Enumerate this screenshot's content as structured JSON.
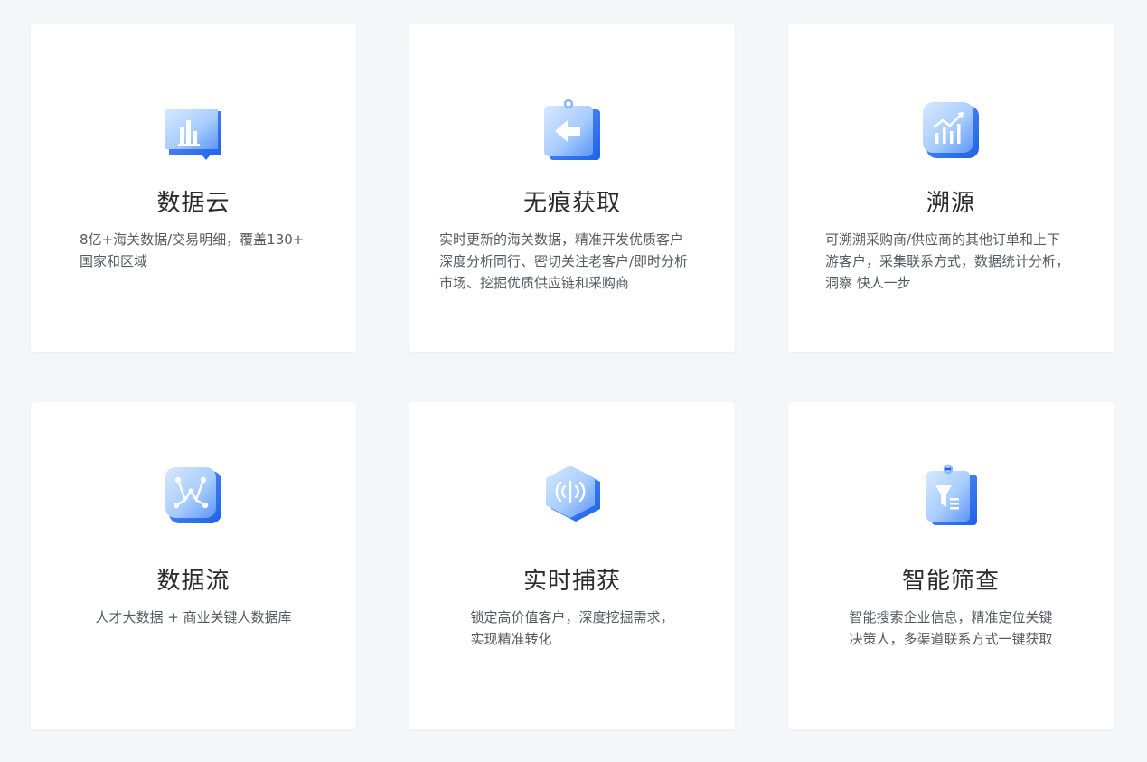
{
  "colors": {
    "page_background": "#f4f7fa",
    "card_background": "#ffffff",
    "title_text": "#2b2b2b",
    "body_text": "#555a60",
    "icon_light": "#bcd9ff",
    "icon_dark": "#2a6ff0"
  },
  "cards": [
    {
      "icon": "bar-chart-icon",
      "title": "数据云",
      "desc_lines": [
        "8亿+海关数据/交易明细，覆盖130+",
        "国家和区域"
      ]
    },
    {
      "icon": "clipboard-arrow-icon",
      "title": "无痕获取",
      "desc_lines": [
        "实时更新的海关数据，精准开发优质客户",
        "深度分析同行、密切关注老客户/即时分析",
        "市场、挖掘优质供应链和采购商"
      ]
    },
    {
      "icon": "trend-chart-icon",
      "title": "溯源",
      "desc_lines": [
        "可溯溯采购商/供应商的其他订单和上下",
        "游客户，采集联系方式，数据统计分析，",
        "洞察 快人一步"
      ]
    },
    {
      "icon": "network-flow-icon",
      "title": "数据流",
      "desc_lines": [
        "人才大数据 + 商业关键人数据库"
      ]
    },
    {
      "icon": "signal-hexagon-icon",
      "title": "实时捕获",
      "desc_lines": [
        "锁定高价值客户，深度挖掘需求，",
        "实现精准转化"
      ]
    },
    {
      "icon": "filter-clipboard-icon",
      "title": "智能筛查",
      "desc_lines": [
        "智能搜索企业信息，精准定位关键",
        "决策人，多渠道联系方式一键获取"
      ]
    }
  ]
}
